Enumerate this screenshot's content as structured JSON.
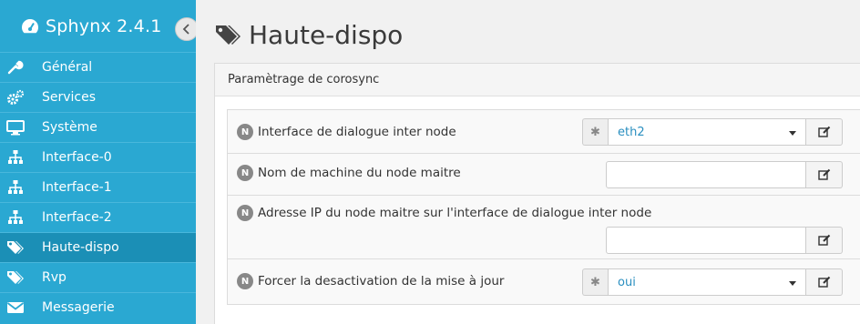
{
  "app": {
    "name": "Sphynx 2.4.1"
  },
  "sidebar": {
    "items": [
      {
        "label": "Général",
        "icon": "wrench-icon"
      },
      {
        "label": "Services",
        "icon": "gears-icon"
      },
      {
        "label": "Système",
        "icon": "desktop-icon"
      },
      {
        "label": "Interface-0",
        "icon": "sitemap-icon"
      },
      {
        "label": "Interface-1",
        "icon": "sitemap-icon"
      },
      {
        "label": "Interface-2",
        "icon": "sitemap-icon"
      },
      {
        "label": "Haute-dispo",
        "icon": "tags-icon",
        "active": true
      },
      {
        "label": "Rvp",
        "icon": "tags-icon"
      },
      {
        "label": "Messagerie",
        "icon": "envelope-icon"
      }
    ]
  },
  "page": {
    "title": "Haute-dispo"
  },
  "panel": {
    "heading": "Paramètrage de corosync"
  },
  "form": {
    "badge": "N",
    "fields": [
      {
        "label": "Interface de dialogue inter node",
        "value": "eth2"
      },
      {
        "label": "Nom de machine du node maitre",
        "value": ""
      },
      {
        "label": "Adresse IP du node maitre sur l'interface de dialogue inter node",
        "value": ""
      },
      {
        "label": "Forcer la desactivation de la mise à jour",
        "value": "oui"
      }
    ],
    "addon_symbol": "✱"
  },
  "colors": {
    "sidebar": "#2aa8d2",
    "active": "#1b8fb6",
    "link": "#2a8fc0"
  }
}
